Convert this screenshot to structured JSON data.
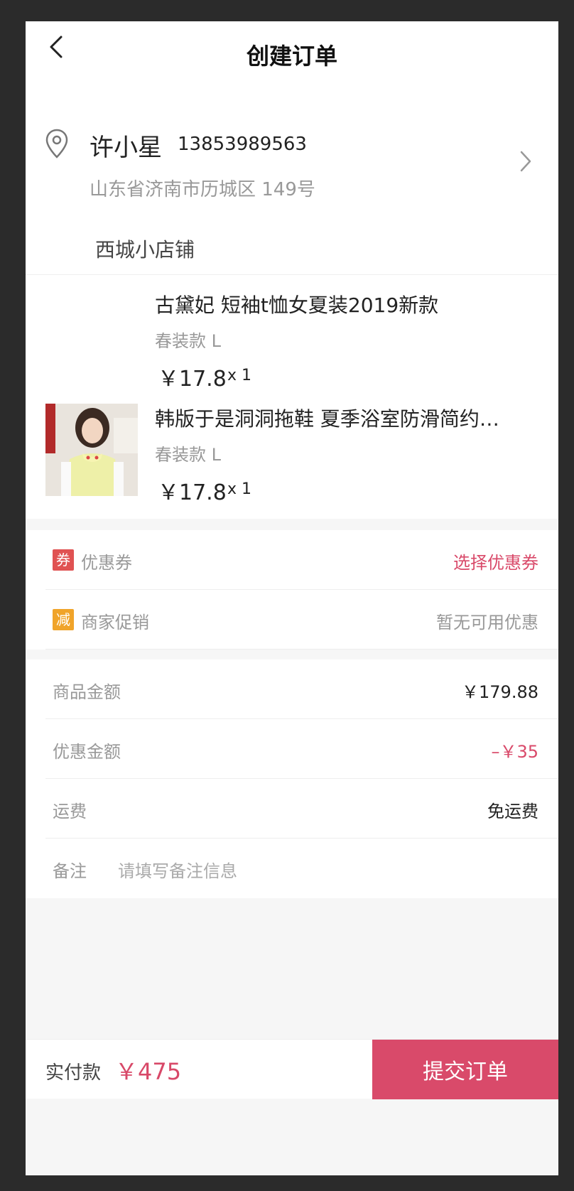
{
  "header": {
    "title": "创建订单"
  },
  "address": {
    "name": "许小星",
    "phone": "13853989563",
    "detail": "山东省济南市历城区 149号"
  },
  "shop": {
    "name": "西城小店铺",
    "products": [
      {
        "title": "古黛妃 短袖t恤女夏装2019新款",
        "spec": "春装款 L",
        "price": "￥17.8",
        "qty": "x 1"
      },
      {
        "title": "韩版于是洞洞拖鞋 夏季浴室防滑简约…",
        "spec": "春装款 L",
        "price": "￥17.8",
        "qty": "x 1"
      }
    ]
  },
  "discounts": {
    "coupon": {
      "badge": "券",
      "label": "优惠券",
      "value": "选择优惠券"
    },
    "promo": {
      "badge": "减",
      "label": "商家促销",
      "value": "暂无可用优惠"
    }
  },
  "summary": {
    "goods_amount": {
      "label": "商品金额",
      "value": "￥179.88"
    },
    "discount_amount": {
      "label": "优惠金额",
      "value": "–￥35"
    },
    "shipping": {
      "label": "运费",
      "value": "免运费"
    },
    "note": {
      "label": "备注",
      "placeholder": "请填写备注信息"
    }
  },
  "footer": {
    "pay_label": "实付款",
    "pay_amount": "￥475",
    "submit_label": "提交订单"
  },
  "colors": {
    "accent": "#d94a6a",
    "coupon_badge": "#e05252",
    "promo_badge": "#f0a42a"
  }
}
